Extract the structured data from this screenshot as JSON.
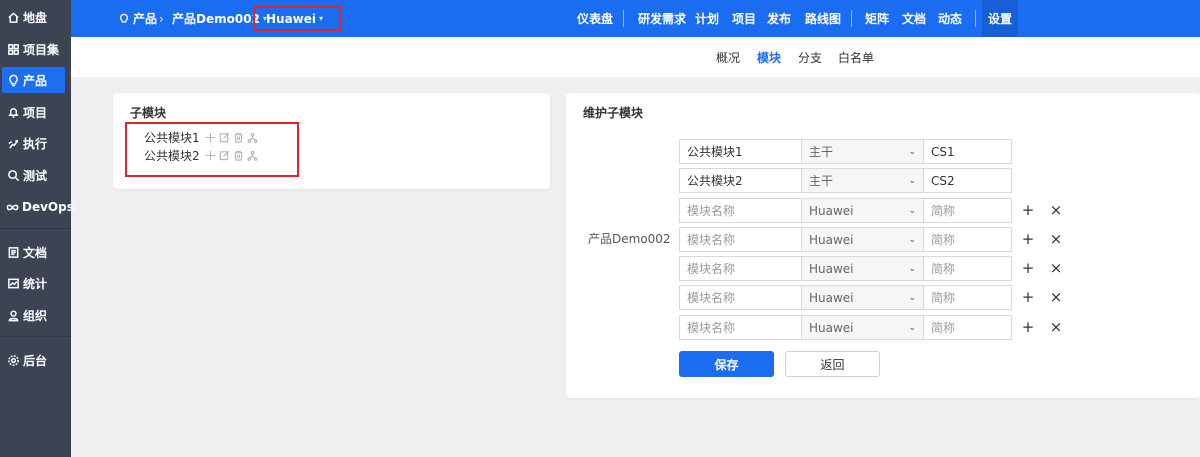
{
  "sidebar": {
    "items": [
      {
        "label": "地盘",
        "icon": "home-icon"
      },
      {
        "label": "项目集",
        "icon": "grid-icon"
      },
      {
        "label": "产品",
        "icon": "lightbulb-icon",
        "active": true
      },
      {
        "label": "项目",
        "icon": "bell-icon"
      },
      {
        "label": "执行",
        "icon": "run-icon"
      },
      {
        "label": "测试",
        "icon": "magnifier-icon"
      },
      {
        "label": "DevOps",
        "icon": "infinity-icon"
      },
      {
        "label": "文档",
        "icon": "doc-icon"
      },
      {
        "label": "统计",
        "icon": "chart-icon"
      },
      {
        "label": "组织",
        "icon": "user-icon"
      },
      {
        "label": "后台",
        "icon": "gear-icon"
      }
    ]
  },
  "topbar": {
    "breadcrumb": {
      "root": "产品",
      "product": "产品Demo002",
      "branch": "Huawei"
    },
    "nav": [
      "仪表盘",
      "研发需求",
      "计划",
      "项目",
      "发布",
      "路线图",
      "矩阵",
      "文档",
      "动态",
      "设置"
    ],
    "active_nav": "设置"
  },
  "subtabs": [
    "概况",
    "模块",
    "分支",
    "白名单"
  ],
  "active_subtab": "模块",
  "left_card": {
    "title": "子模块",
    "modules": [
      "公共模块1",
      "公共模块2"
    ]
  },
  "right_card": {
    "title": "维护子模块",
    "parent_label": "产品Demo002",
    "rows": [
      {
        "name": "公共模块1",
        "branch": "主干",
        "short": "CS1",
        "editable_actions": false
      },
      {
        "name": "公共模块2",
        "branch": "主干",
        "short": "CS2",
        "editable_actions": false
      },
      {
        "name": "",
        "branch": "Huawei",
        "short": "",
        "editable_actions": true
      },
      {
        "name": "",
        "branch": "Huawei",
        "short": "",
        "editable_actions": true
      },
      {
        "name": "",
        "branch": "Huawei",
        "short": "",
        "editable_actions": true
      },
      {
        "name": "",
        "branch": "Huawei",
        "short": "",
        "editable_actions": true
      },
      {
        "name": "",
        "branch": "Huawei",
        "short": "",
        "editable_actions": true
      }
    ],
    "name_placeholder": "模块名称",
    "short_placeholder": "简称",
    "save_label": "保存",
    "back_label": "返回"
  },
  "colors": {
    "primary": "#1a6cf0",
    "sidebar_bg": "#3c4353",
    "highlight_box": "#e0242b"
  }
}
